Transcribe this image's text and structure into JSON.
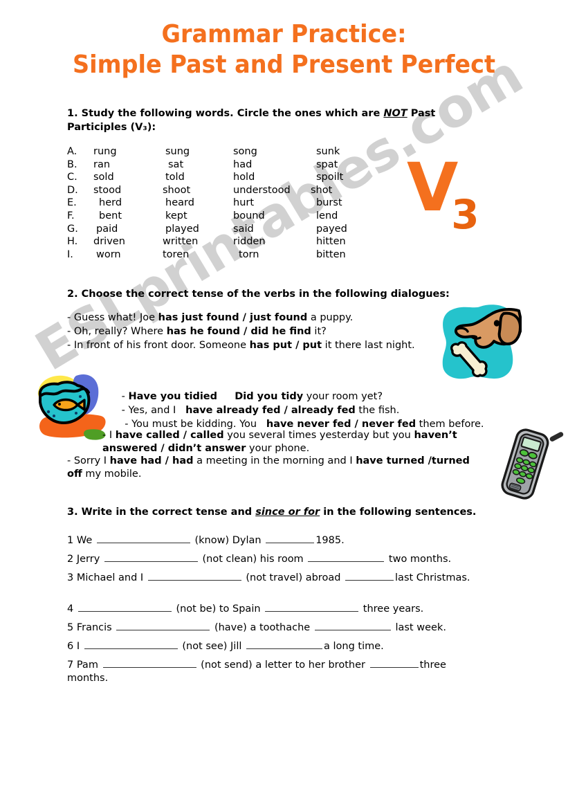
{
  "watermark": {
    "text": "ESLprintables.com"
  },
  "title": {
    "line1": "Grammar Practice:",
    "line2": "Simple Past and Present Perfect",
    "color": "#f4701e"
  },
  "exercise1": {
    "instruction_pre": "1. Study the following words. Circle the ones which are ",
    "instruction_emph": "NOT",
    "instruction_post": " Past Participles (V₃):",
    "rows": [
      {
        "letter": "A.",
        "words": [
          "rung",
          "sung",
          "song",
          "sunk"
        ]
      },
      {
        "letter": "B.",
        "words": [
          "ran",
          "sat",
          "had",
          "spat"
        ]
      },
      {
        "letter": "C.",
        "words": [
          "sold",
          "told",
          "hold",
          "spoilt"
        ]
      },
      {
        "letter": "D.",
        "words": [
          "stood",
          "shoot",
          "understood",
          "shot"
        ]
      },
      {
        "letter": "E.",
        "words": [
          "herd",
          "heard",
          "hurt",
          "burst"
        ]
      },
      {
        "letter": "F.",
        "words": [
          "bent",
          "kept",
          "bound",
          "lend"
        ]
      },
      {
        "letter": "G.",
        "words": [
          "paid",
          "played",
          "said",
          "payed"
        ]
      },
      {
        "letter": "H.",
        "words": [
          "driven",
          "written",
          "ridden",
          "hitten"
        ]
      },
      {
        "letter": "I.",
        "words": [
          "worn",
          "toren",
          "torn",
          "bitten"
        ]
      }
    ],
    "graphic": {
      "letter": "V",
      "subscript": "3",
      "color": "#f4701e"
    }
  },
  "exercise2": {
    "instruction": "2. Choose the correct tense of the verbs in the following dialogues:",
    "dialogue1": [
      {
        "plain1": "- Guess what! Joe ",
        "bold": "has just found / just found",
        "plain2": " a puppy."
      },
      {
        "plain1": "- Oh, really? Where ",
        "bold": "has he found / did he find",
        "plain2": " it?"
      },
      {
        "plain1": "- In front of his front door. Someone ",
        "bold": "has put / put",
        "plain2": " it there last night."
      }
    ],
    "dialogue2": [
      {
        "plain1": "- ",
        "bold": "Have you tidied     Did you tidy",
        "plain2": " your room yet?"
      },
      {
        "plain1": "- Yes, and I   ",
        "bold": "have already fed / already fed",
        "plain2": " the fish."
      },
      {
        "plain1": " - You must be kidding. You   ",
        "bold": "have never fed / never fed",
        "plain2": " them before."
      }
    ],
    "dialogue3": [
      {
        "plain1": "  - I ",
        "bold": "have called / called",
        "plain2": " you several times yesterday but you ",
        "bold2": "haven’t answered / didn’t answer",
        "plain3": " your phone."
      },
      {
        "plain1": "- Sorry I ",
        "bold": "have had / had",
        "plain2": " a meeting in the morning and I ",
        "bold2": "have turned /turned off",
        "plain3": " my mobile."
      }
    ],
    "clipart": [
      "dog-with-bone",
      "fishbowl",
      "mobile-phone"
    ]
  },
  "exercise3": {
    "instruction_pre": "3. Write in the correct tense and ",
    "instruction_emph": "since or for",
    "instruction_post": " in the following sentences.",
    "items": [
      {
        "num": "1",
        "p1": "We ",
        "p2": " (know) Dylan  ",
        "p3": "1985."
      },
      {
        "num": "2",
        "p1": "Jerry ",
        "p2": " (not clean) his room ",
        "p3": " two months."
      },
      {
        "num": "3",
        "p1": "Michael and I ",
        "p2": " (not travel) abroad ",
        "p3": "last Christmas."
      },
      {
        "num": "4",
        "p1": "",
        "p2": " (not be) to Spain ",
        "p3": " three years."
      },
      {
        "num": "5",
        "p1": "Francis ",
        "p2": " (have) a toothache ",
        "p3": " last week."
      },
      {
        "num": "6",
        "p1": "I ",
        "p2": " (not see) Jill ",
        "p3": "a long time."
      },
      {
        "num": "7",
        "p1": "Pam ",
        "p2": " (not send) a letter to her brother ",
        "p3": "three months."
      }
    ]
  }
}
